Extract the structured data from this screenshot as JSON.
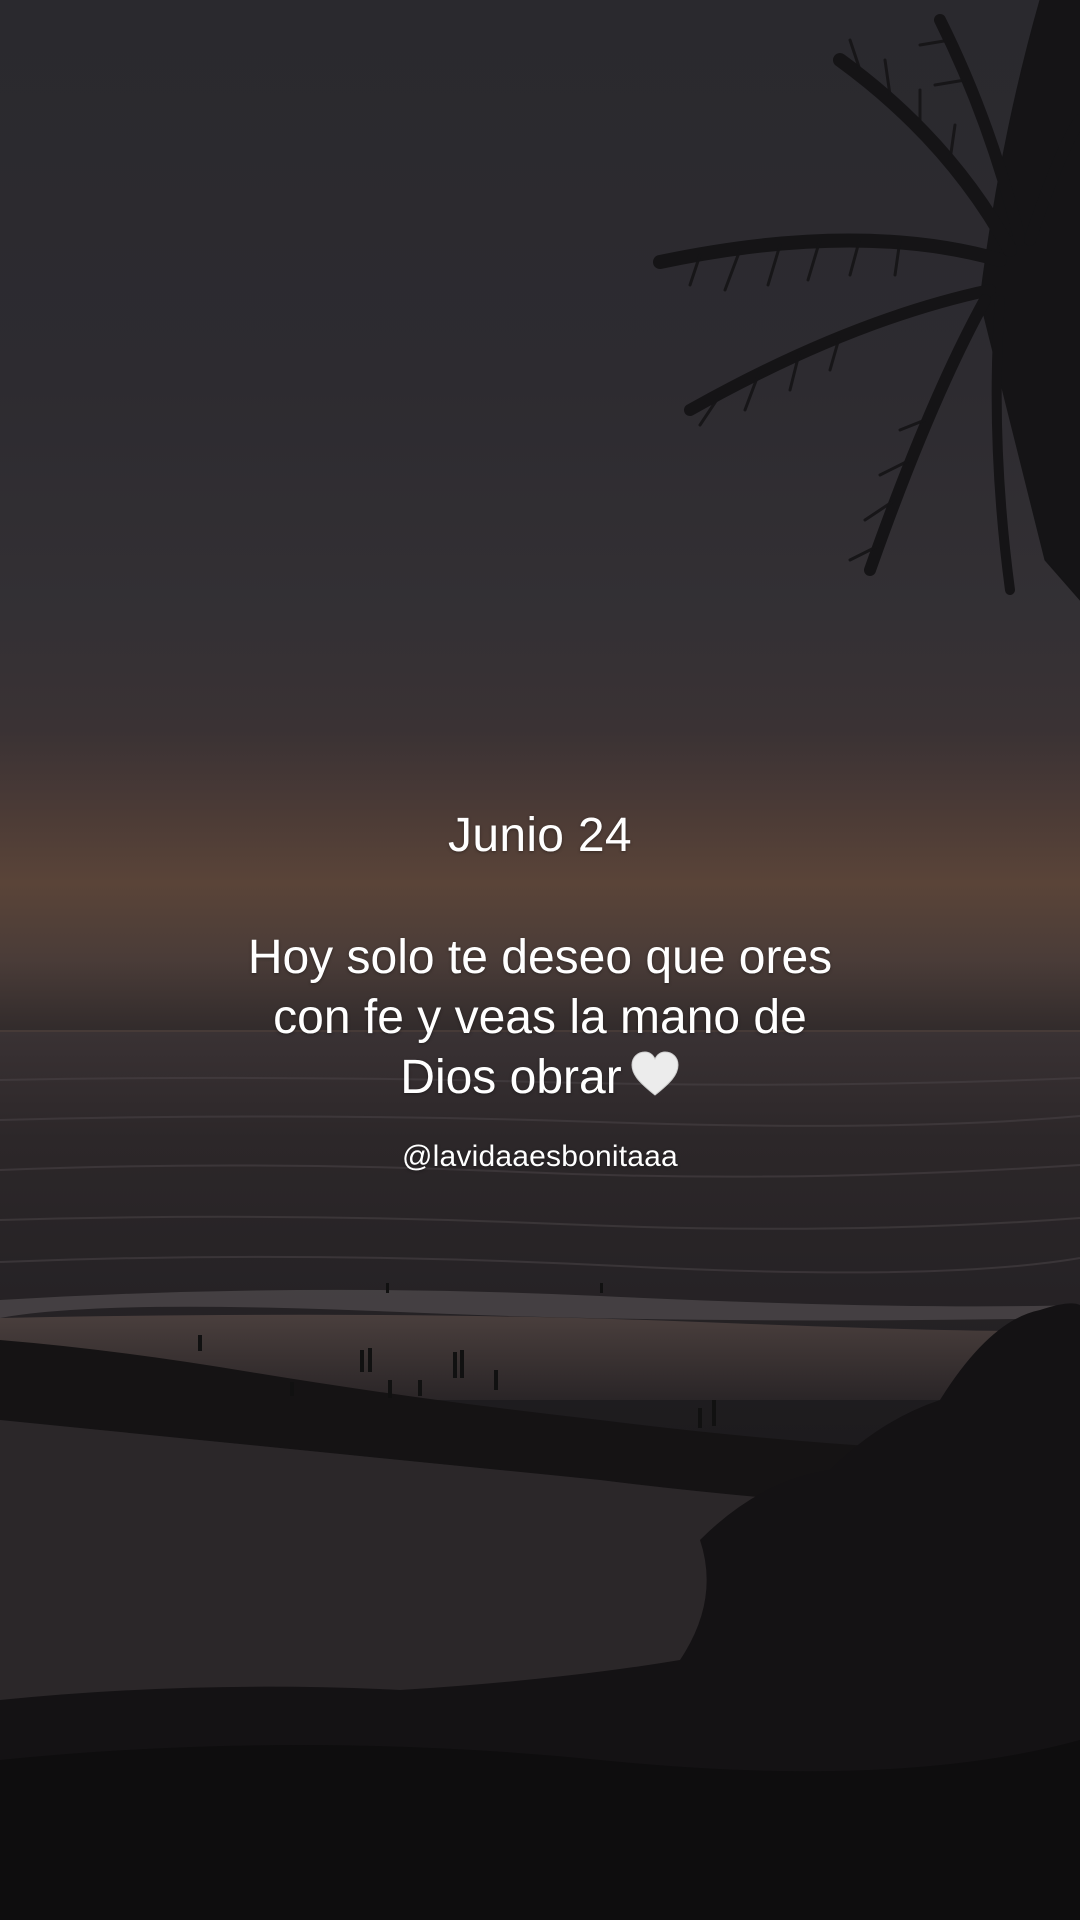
{
  "post": {
    "date": "Junio 24",
    "message_lines": [
      "Hoy solo te deseo que ores",
      "con fe y veas la mano de",
      "Dios obrar"
    ],
    "emoji": "white-heart-icon",
    "handle": "@lavidaaesbonitaaa"
  },
  "scene": {
    "description_icons": [
      "palm-tree-icon",
      "sea-waves",
      "beach-shoreline",
      "vegetation-silhouette"
    ]
  },
  "colors": {
    "text": "#ffffff",
    "sky_top": "#2a292e",
    "horizon_glow": "#5a4438",
    "sea": "#2a2628",
    "foreground": "#121112"
  }
}
